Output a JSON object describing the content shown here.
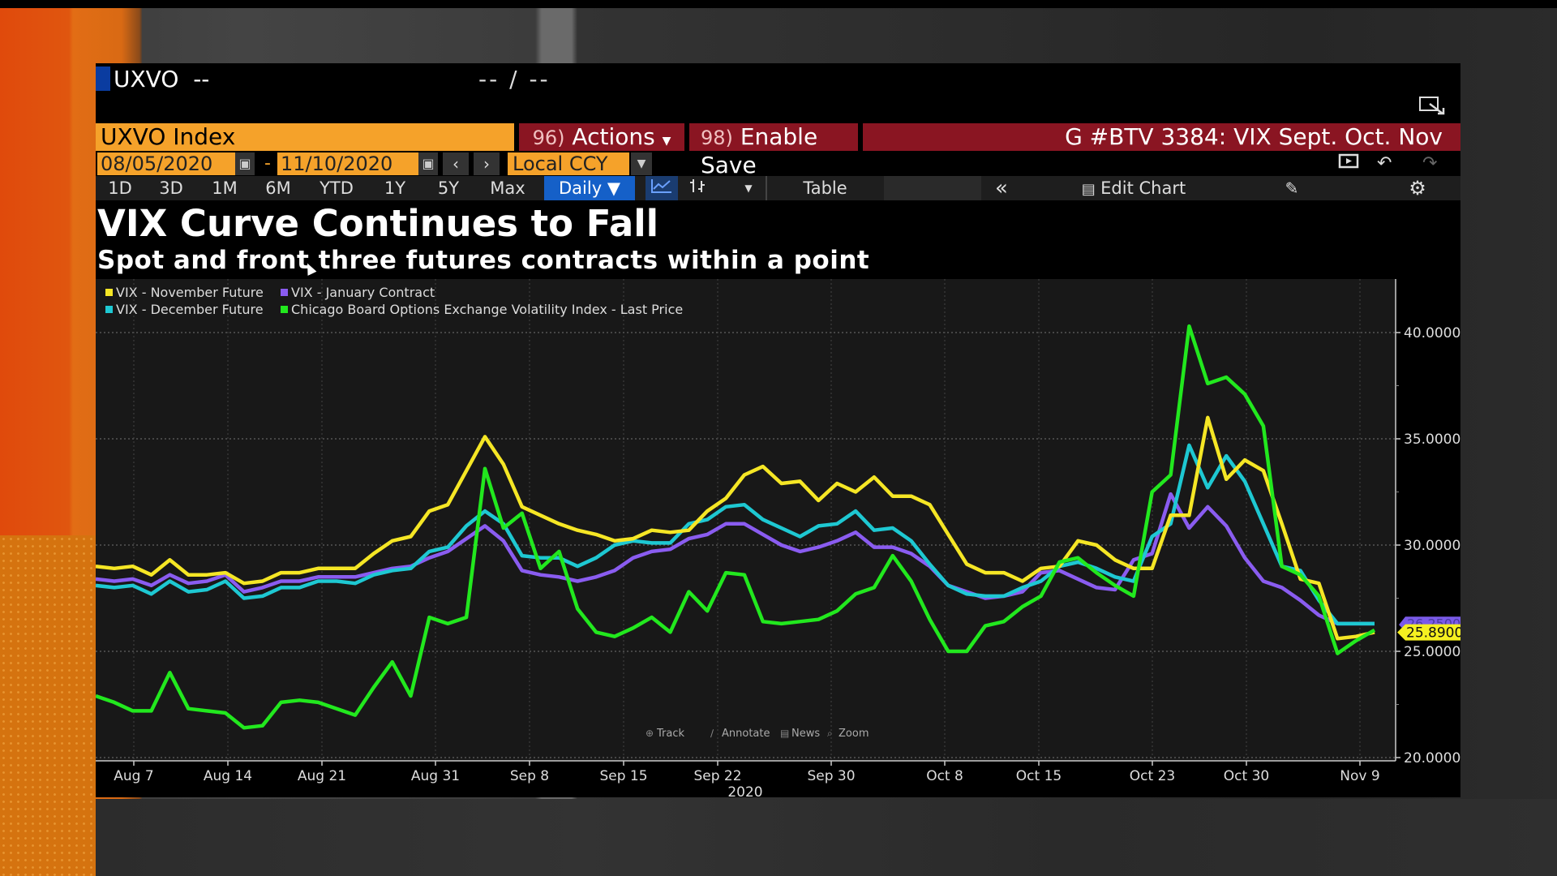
{
  "header": {
    "ticker": "UXVO",
    "ticker_suffix": "--",
    "price_change": "-- / --"
  },
  "toolbar": {
    "security": "UXVO Index",
    "actions_num": "96)",
    "actions_label": "Actions",
    "save_num": "98)",
    "save_label": "Enable Save",
    "chart_title": "G #BTV 3384: VIX Sept. Oct. Nov",
    "start_date": "08/05/2020",
    "end_date": "11/10/2020",
    "currency": "Local CCY",
    "ranges": [
      "1D",
      "3D",
      "1M",
      "6M",
      "YTD",
      "1Y",
      "5Y",
      "Max"
    ],
    "frequency": "Daily",
    "table_label": "Table",
    "edit_chart_label": "Edit Chart"
  },
  "icons": {
    "calendar": "calendar-icon",
    "prev": "chevron-left-icon",
    "next": "chevron-right-icon",
    "dropdown": "chevron-down-icon",
    "line_chart": "line-chart-icon",
    "bar_style": "bar-style-icon",
    "collapse": "double-chevron-left-icon",
    "edit_chart": "edit-chart-icon",
    "annotate_pen": "pen-icon",
    "settings": "gear-icon",
    "present": "presentation-icon",
    "undo": "undo-icon",
    "redo": "redo-icon",
    "popout": "popout-icon"
  },
  "chart_tools": [
    "Track",
    "Annotate",
    "News",
    "Zoom"
  ],
  "colors": {
    "november": "#f5e625",
    "december": "#1ec8d2",
    "january": "#8a5cf0",
    "spot": "#22e81e",
    "security_field": "#f5a22a",
    "red_bar": "#8a1522",
    "daily_active": "#1560c8"
  },
  "chart_data": {
    "type": "line",
    "title": "VIX Curve Continues to Fall",
    "subtitle": "Spot and front three futures contracts within a point",
    "xlabel": "2020",
    "ylabel": "",
    "ylim": [
      20,
      42
    ],
    "yticks": [
      20,
      25,
      30,
      35,
      40
    ],
    "ytick_labels": [
      "20.0000",
      "25.0000",
      "30.0000",
      "35.0000",
      "40.0000"
    ],
    "xtick_labels": [
      "Aug 7",
      "Aug 14",
      "Aug 21",
      "Aug 31",
      "Sep 8",
      "Sep 15",
      "Sep 22",
      "Sep 30",
      "Oct 8",
      "Oct 15",
      "Oct 23",
      "Oct 30",
      "Nov 9"
    ],
    "xtick_index": [
      2,
      9,
      16,
      23,
      30,
      37,
      44,
      52,
      60,
      67,
      75,
      82,
      89
    ],
    "x_count": 94,
    "grid": true,
    "legend_position": "top-left",
    "last_price_label": "25.8900",
    "last_price_label_hidden": "26.2500",
    "series": [
      {
        "name": "VIX - November Future",
        "color": "#f5e625",
        "values": [
          29.0,
          28.9,
          29.0,
          28.6,
          29.3,
          28.6,
          28.6,
          28.7,
          28.2,
          28.3,
          28.7,
          28.7,
          28.9,
          28.9,
          28.9,
          29.6,
          30.2,
          30.4,
          31.6,
          31.9,
          33.5,
          35.1,
          33.8,
          31.8,
          31.4,
          31.0,
          30.7,
          30.5,
          30.2,
          30.3,
          30.7,
          30.6,
          30.7,
          31.6,
          32.2,
          33.3,
          33.7,
          32.9,
          33.0,
          32.1,
          32.9,
          32.5,
          33.2,
          32.3,
          32.3,
          31.9,
          30.5,
          29.1,
          28.7,
          28.7,
          28.3,
          28.9,
          29.0,
          30.2,
          30.0,
          29.3,
          28.9,
          28.9,
          31.4,
          31.4,
          36.0,
          33.1,
          34.0,
          33.5,
          31.0,
          28.4,
          28.2,
          25.6,
          25.7,
          25.9,
          26.0,
          26.0,
          26.0,
          26.0,
          26.0,
          26.0,
          26.0,
          26.0,
          26.0,
          26.0,
          26.0,
          26.0,
          26.0,
          26.0,
          26.0,
          26.0,
          26.0,
          26.0,
          26.0,
          26.0,
          26.0,
          26.0,
          26.0,
          25.89
        ]
      },
      {
        "name": "VIX - December Future",
        "color": "#1ec8d2",
        "values": [
          28.1,
          28.0,
          28.1,
          27.7,
          28.3,
          27.8,
          27.9,
          28.3,
          27.5,
          27.6,
          28.0,
          28.0,
          28.3,
          28.3,
          28.2,
          28.6,
          28.8,
          28.9,
          29.7,
          29.9,
          30.9,
          31.6,
          31.0,
          29.5,
          29.4,
          29.4,
          29.0,
          29.4,
          30.0,
          30.2,
          30.1,
          30.1,
          31.0,
          31.2,
          31.8,
          31.9,
          31.2,
          30.8,
          30.4,
          30.9,
          31.0,
          31.6,
          30.7,
          30.8,
          30.2,
          29.1,
          28.1,
          27.7,
          27.6,
          27.6,
          28.0,
          28.3,
          29.0,
          29.2,
          28.9,
          28.5,
          28.3,
          30.4,
          31.0,
          34.7,
          32.7,
          34.2,
          33.0,
          31.0,
          29.0,
          28.8,
          27.4,
          26.3,
          26.3,
          26.3,
          26.3,
          26.3,
          26.3,
          26.3,
          26.3,
          26.3,
          26.3,
          26.3,
          26.3,
          26.3,
          26.3,
          26.3,
          26.3,
          26.3,
          26.3,
          26.3,
          26.3,
          26.3,
          26.3,
          26.3,
          26.3,
          26.3,
          26.3,
          26.25
        ]
      },
      {
        "name": "VIX - January Contract",
        "color": "#8a5cf0",
        "values": [
          28.4,
          28.3,
          28.4,
          28.1,
          28.6,
          28.2,
          28.3,
          28.6,
          27.8,
          28.0,
          28.3,
          28.3,
          28.5,
          28.5,
          28.5,
          28.7,
          28.9,
          29.0,
          29.4,
          29.7,
          30.3,
          30.9,
          30.2,
          28.8,
          28.6,
          28.5,
          28.3,
          28.5,
          28.8,
          29.4,
          29.7,
          29.8,
          30.3,
          30.5,
          31.0,
          31.0,
          30.5,
          30.0,
          29.7,
          29.9,
          30.2,
          30.6,
          29.9,
          29.9,
          29.6,
          29.0,
          28.1,
          27.8,
          27.5,
          27.6,
          27.8,
          28.7,
          28.8,
          28.4,
          28.0,
          27.9,
          29.3,
          29.6,
          32.4,
          30.8,
          31.8,
          30.9,
          29.4,
          28.3,
          28.0,
          27.4,
          26.7,
          26.3,
          26.3,
          26.3,
          26.3,
          26.3,
          26.3,
          26.3,
          26.3,
          26.3,
          26.3,
          26.3,
          26.3,
          26.3,
          26.3,
          26.3,
          26.3,
          26.3,
          26.3,
          26.3,
          26.3,
          26.3,
          26.3,
          26.3,
          26.3,
          26.3,
          26.3,
          26.25
        ]
      },
      {
        "name": "Chicago Board Options Exchange Volatility Index - Last Price",
        "color": "#22e81e",
        "values": [
          22.9,
          22.6,
          22.2,
          22.2,
          24.0,
          22.3,
          22.2,
          22.1,
          21.4,
          21.5,
          22.6,
          22.7,
          22.6,
          22.3,
          22.0,
          23.3,
          24.5,
          22.9,
          26.6,
          26.3,
          26.6,
          33.6,
          30.8,
          31.5,
          28.9,
          29.7,
          27.0,
          25.9,
          25.7,
          26.1,
          26.6,
          25.9,
          27.8,
          26.9,
          28.7,
          28.6,
          26.4,
          26.3,
          26.4,
          26.5,
          26.9,
          27.7,
          28.0,
          29.5,
          28.3,
          26.5,
          25.0,
          25.0,
          26.2,
          26.4,
          27.1,
          27.6,
          29.2,
          29.4,
          28.7,
          28.1,
          27.6,
          32.5,
          33.3,
          40.3,
          37.6,
          37.9,
          37.1,
          35.6,
          29.0,
          28.6,
          27.6,
          24.9,
          25.5,
          26.0,
          26.0,
          26.0,
          26.0,
          26.0,
          26.0,
          26.0,
          26.0,
          26.0,
          26.0,
          26.0,
          26.0,
          26.0,
          26.0,
          26.0,
          26.0,
          26.0,
          26.0,
          26.0,
          26.0,
          26.0,
          26.0,
          26.0,
          26.0,
          26.0
        ]
      }
    ]
  }
}
